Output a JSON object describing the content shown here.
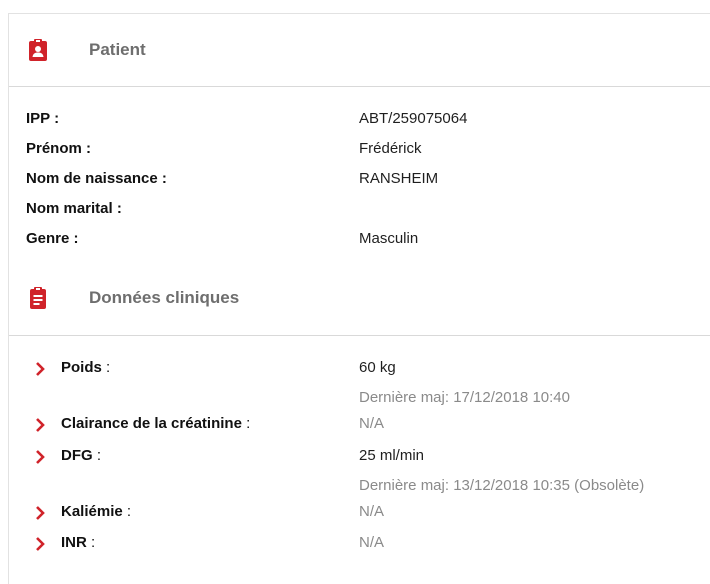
{
  "patient": {
    "title": "Patient",
    "icon": "id-badge-icon",
    "accent": "#d0232a",
    "fields": [
      {
        "label": "IPP :",
        "value": "ABT/259075064"
      },
      {
        "label": "Prénom :",
        "value": "Frédérick"
      },
      {
        "label": "Nom de naissance :",
        "value": "RANSHEIM"
      },
      {
        "label": "Nom marital :",
        "value": ""
      },
      {
        "label": "Genre :",
        "value": "Masculin"
      }
    ]
  },
  "clinical": {
    "title": "Données cliniques",
    "icon": "clipboard-icon",
    "colon": " :",
    "items": [
      {
        "label": "Poids",
        "value": "60 kg",
        "updated": "Dernière maj: 17/12/2018 10:40",
        "obsolete": ""
      },
      {
        "label": "Clairance de la créatinine",
        "value": "N/A"
      },
      {
        "label": "DFG",
        "value": "25 ml/min",
        "updated": "Dernière maj: 13/12/2018 10:35",
        "obsolete": "(Obsolète)"
      },
      {
        "label": "Kaliémie",
        "value": "N/A"
      },
      {
        "label": "INR",
        "value": "N/A"
      }
    ]
  }
}
